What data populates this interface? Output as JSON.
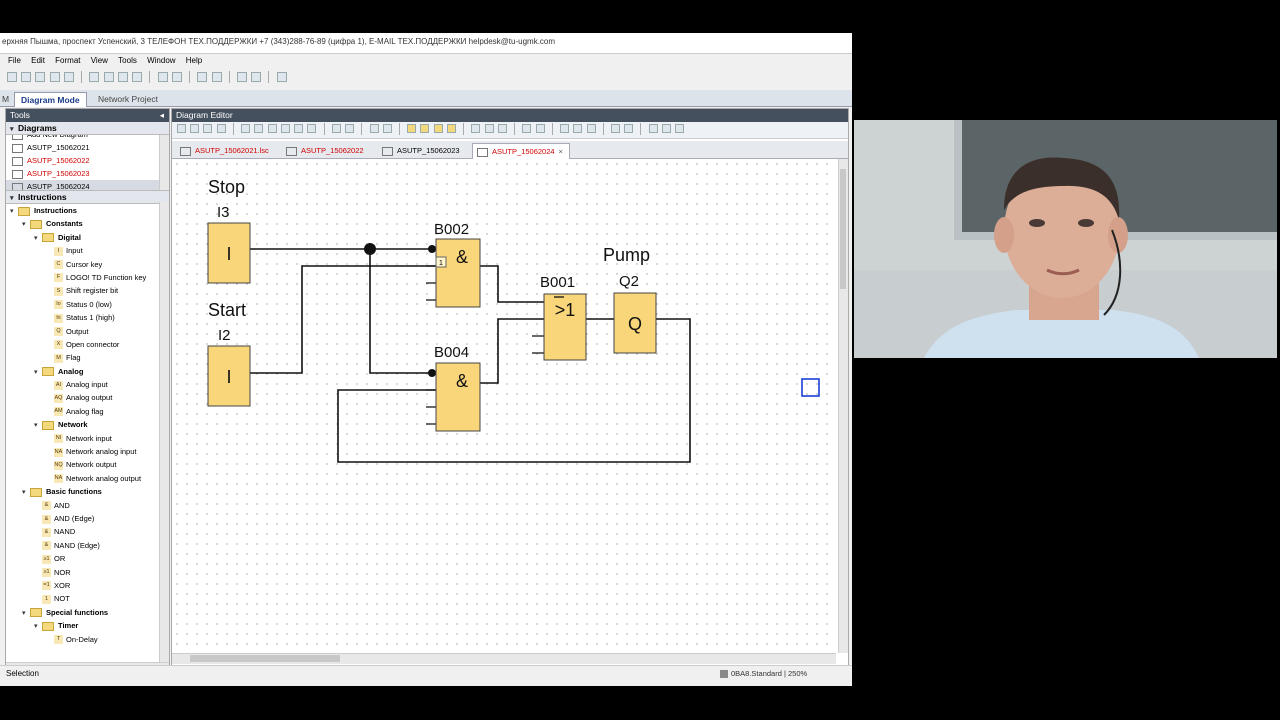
{
  "window": {
    "title": "ерхняя Пышма, проспект Успенский, 3 ТЕЛЕФОН ТЕХ.ПОДДЕРЖКИ +7 (343)288-76-89 (цифра 1), E-MAIL ТЕХ.ПОДДЕРЖКИ helpdesk@tu-ugmk.com"
  },
  "menu": [
    "File",
    "Edit",
    "Format",
    "View",
    "Tools",
    "Window",
    "Help"
  ],
  "mode_tabs": {
    "diagram_mode": "Diagram Mode",
    "network_project": "Network Project",
    "left_fragment": "М"
  },
  "tools_panel": {
    "title": "Tools",
    "diagrams_header": "Diagrams",
    "diagrams": [
      {
        "label": "Add New Diagram",
        "color": "#000000"
      },
      {
        "label": "ASUTP_15062021",
        "color": "#000000"
      },
      {
        "label": "ASUTP_15062022",
        "color": "#d00000"
      },
      {
        "label": "ASUTP_15062023",
        "color": "#d00000"
      },
      {
        "label": "ASUTP_15062024",
        "color": "#000000"
      }
    ],
    "instructions_header": "Instructions",
    "tree": [
      {
        "label": "Instructions",
        "level": 0,
        "type": "folder"
      },
      {
        "label": "Constants",
        "level": 1,
        "type": "folder"
      },
      {
        "label": "Digital",
        "level": 2,
        "type": "folder"
      },
      {
        "label": "Input",
        "level": 3,
        "icon": "I"
      },
      {
        "label": "Cursor key",
        "level": 3,
        "icon": "C"
      },
      {
        "label": "LOGO! TD Function key",
        "level": 3,
        "icon": "F"
      },
      {
        "label": "Shift register bit",
        "level": 3,
        "icon": "S"
      },
      {
        "label": "Status 0 (low)",
        "level": 3,
        "icon": "lo"
      },
      {
        "label": "Status 1 (high)",
        "level": 3,
        "icon": "hi"
      },
      {
        "label": "Output",
        "level": 3,
        "icon": "Q"
      },
      {
        "label": "Open connector",
        "level": 3,
        "icon": "X"
      },
      {
        "label": "Flag",
        "level": 3,
        "icon": "M"
      },
      {
        "label": "Analog",
        "level": 2,
        "type": "folder"
      },
      {
        "label": "Analog input",
        "level": 3,
        "icon": "AI"
      },
      {
        "label": "Analog output",
        "level": 3,
        "icon": "AQ"
      },
      {
        "label": "Analog flag",
        "level": 3,
        "icon": "AM"
      },
      {
        "label": "Network",
        "level": 2,
        "type": "folder"
      },
      {
        "label": "Network input",
        "level": 3,
        "icon": "NI"
      },
      {
        "label": "Network analog input",
        "level": 3,
        "icon": "NA"
      },
      {
        "label": "Network output",
        "level": 3,
        "icon": "NQ"
      },
      {
        "label": "Network analog output",
        "level": 3,
        "icon": "NA"
      },
      {
        "label": "Basic functions",
        "level": 1,
        "type": "folder"
      },
      {
        "label": "AND",
        "level": 2,
        "icon": "&"
      },
      {
        "label": "AND (Edge)",
        "level": 2,
        "icon": "&"
      },
      {
        "label": "NAND",
        "level": 2,
        "icon": "&"
      },
      {
        "label": "NAND (Edge)",
        "level": 2,
        "icon": "&"
      },
      {
        "label": "OR",
        "level": 2,
        "icon": "≥1"
      },
      {
        "label": "NOR",
        "level": 2,
        "icon": "≥1"
      },
      {
        "label": "XOR",
        "level": 2,
        "icon": "=1"
      },
      {
        "label": "NOT",
        "level": 2,
        "icon": "1"
      },
      {
        "label": "Special functions",
        "level": 1,
        "type": "folder"
      },
      {
        "label": "Timer",
        "level": 2,
        "type": "folder"
      },
      {
        "label": "On-Delay",
        "level": 3,
        "icon": "T"
      }
    ]
  },
  "editor": {
    "title": "Diagram Editor",
    "tabs": [
      {
        "label": "ASUTP_15062021.lsc",
        "color": "#d00000"
      },
      {
        "label": "ASUTP_15062022",
        "color": "#d00000"
      },
      {
        "label": "ASUTP_15062023",
        "color": "#000000"
      },
      {
        "label": "ASUTP_15062024",
        "color": "#d00000",
        "active": true
      }
    ],
    "diagram": {
      "stop_label": "Stop",
      "start_label": "Start",
      "pump_label": "Pump",
      "i3": {
        "name": "I3",
        "symbol": "I"
      },
      "i2": {
        "name": "I2",
        "symbol": "I"
      },
      "b002": {
        "name": "B002",
        "symbol": "&"
      },
      "b004": {
        "name": "B004",
        "symbol": "&"
      },
      "b001": {
        "name": "B001",
        "symbol": ">1"
      },
      "q2": {
        "name": "Q2",
        "symbol": "Q"
      },
      "param_marker": "1"
    }
  },
  "status": {
    "left": "Selection",
    "right": "0BA8.Standard",
    "zoom": "250%"
  },
  "colors": {
    "block_fill": "#f9d67a",
    "panel_header": "#45505e",
    "modified_tab": "#d00000",
    "selection_box": "#1a3fd6"
  }
}
